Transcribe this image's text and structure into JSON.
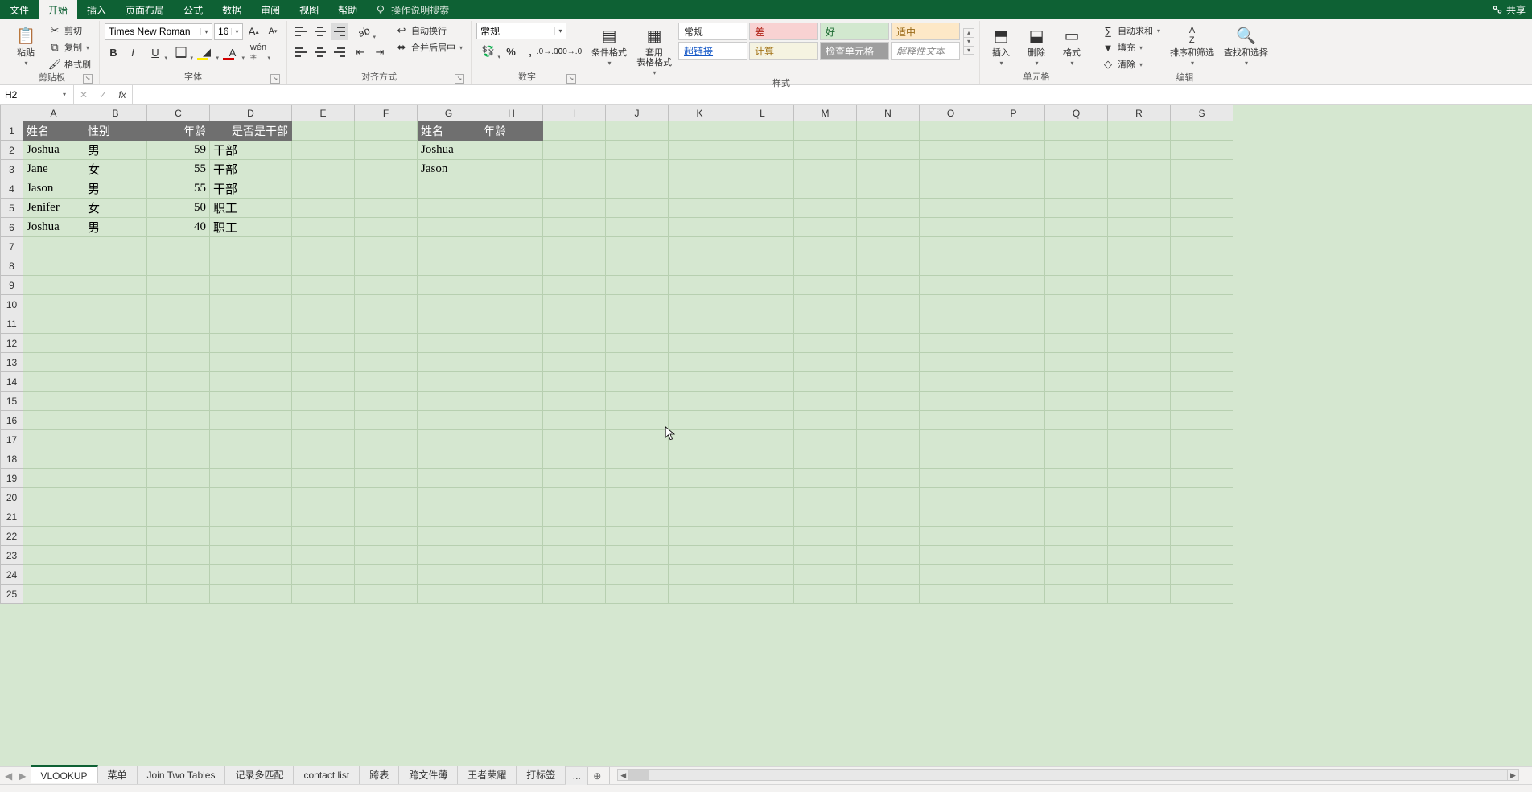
{
  "tabs": {
    "file": "文件",
    "home": "开始",
    "insert": "插入",
    "layout": "页面布局",
    "formulas": "公式",
    "data": "数据",
    "review": "审阅",
    "view": "视图",
    "help": "帮助"
  },
  "tellme": "操作说明搜索",
  "share": "共享",
  "clipboard": {
    "paste": "粘贴",
    "cut": "剪切",
    "copy": "复制",
    "painter": "格式刷",
    "label": "剪贴板"
  },
  "font": {
    "name": "Times New Roman",
    "size": "16",
    "label": "字体"
  },
  "alignment": {
    "wrap": "自动换行",
    "merge": "合并后居中",
    "label": "对齐方式"
  },
  "number": {
    "format": "常规",
    "label": "数字"
  },
  "styles": {
    "condfmt": "条件格式",
    "tablefmt": "套用\n表格格式",
    "g": [
      "常规",
      "差",
      "好",
      "适中",
      "超链接",
      "计算",
      "检查单元格",
      "解释性文本"
    ],
    "label": "样式"
  },
  "stylecolors": {
    "bg": [
      "#ffffff",
      "#f8d2d2",
      "#d2e8cf",
      "#fde8c7",
      "#ffffff",
      "#f5f3e1",
      "#9e9e9e",
      "#ffffff"
    ],
    "fg": [
      "#333333",
      "#b02318",
      "#1d6b32",
      "#9a6a17",
      "#1457c6",
      "#a37418",
      "#ffffff",
      "#8a8a8a"
    ],
    "it": [
      false,
      false,
      false,
      false,
      false,
      false,
      false,
      true
    ],
    "ul": [
      false,
      false,
      false,
      false,
      true,
      false,
      false,
      false
    ]
  },
  "cells": {
    "insert": "插入",
    "delete": "删除",
    "format": "格式",
    "label": "单元格"
  },
  "editing": {
    "sum": "自动求和",
    "fill": "填充",
    "clear": "清除",
    "sort": "排序和筛选",
    "find": "查找和选择",
    "label": "编辑"
  },
  "namebox": "H2",
  "columns": [
    "A",
    "B",
    "C",
    "D",
    "E",
    "F",
    "G",
    "H",
    "I",
    "J",
    "K",
    "L",
    "M",
    "N",
    "O",
    "P",
    "Q",
    "R",
    "S"
  ],
  "colwidths": [
    "colA",
    "colB",
    "colC",
    "colD",
    "colE",
    "colF",
    "colG",
    "colH",
    "colRest",
    "colRest",
    "colRest",
    "colRest",
    "colRest",
    "colRest",
    "colRest",
    "colRest",
    "colRest",
    "colRest",
    "colRest"
  ],
  "rows": 25,
  "data1": {
    "headers": [
      "姓名",
      "性别",
      "年龄",
      "是否是干部"
    ],
    "rows": [
      [
        "Joshua",
        "男",
        "59",
        "干部"
      ],
      [
        "Jane",
        "女",
        "55",
        "干部"
      ],
      [
        "Jason",
        "男",
        "55",
        "干部"
      ],
      [
        "Jenifer",
        "女",
        "50",
        "职工"
      ],
      [
        "Joshua",
        "男",
        "40",
        "职工"
      ]
    ]
  },
  "data2": {
    "headers": [
      "姓名",
      "年龄"
    ],
    "rows": [
      [
        "Joshua",
        ""
      ],
      [
        "Jason",
        ""
      ]
    ]
  },
  "sheets": {
    "active": "VLOOKUP",
    "list": [
      "VLOOKUP",
      "菜单",
      "Join Two Tables",
      "记录多匹配",
      "contact list",
      "跨表",
      "跨文件薄",
      "王者荣耀",
      "打标签"
    ],
    "more": "..."
  }
}
